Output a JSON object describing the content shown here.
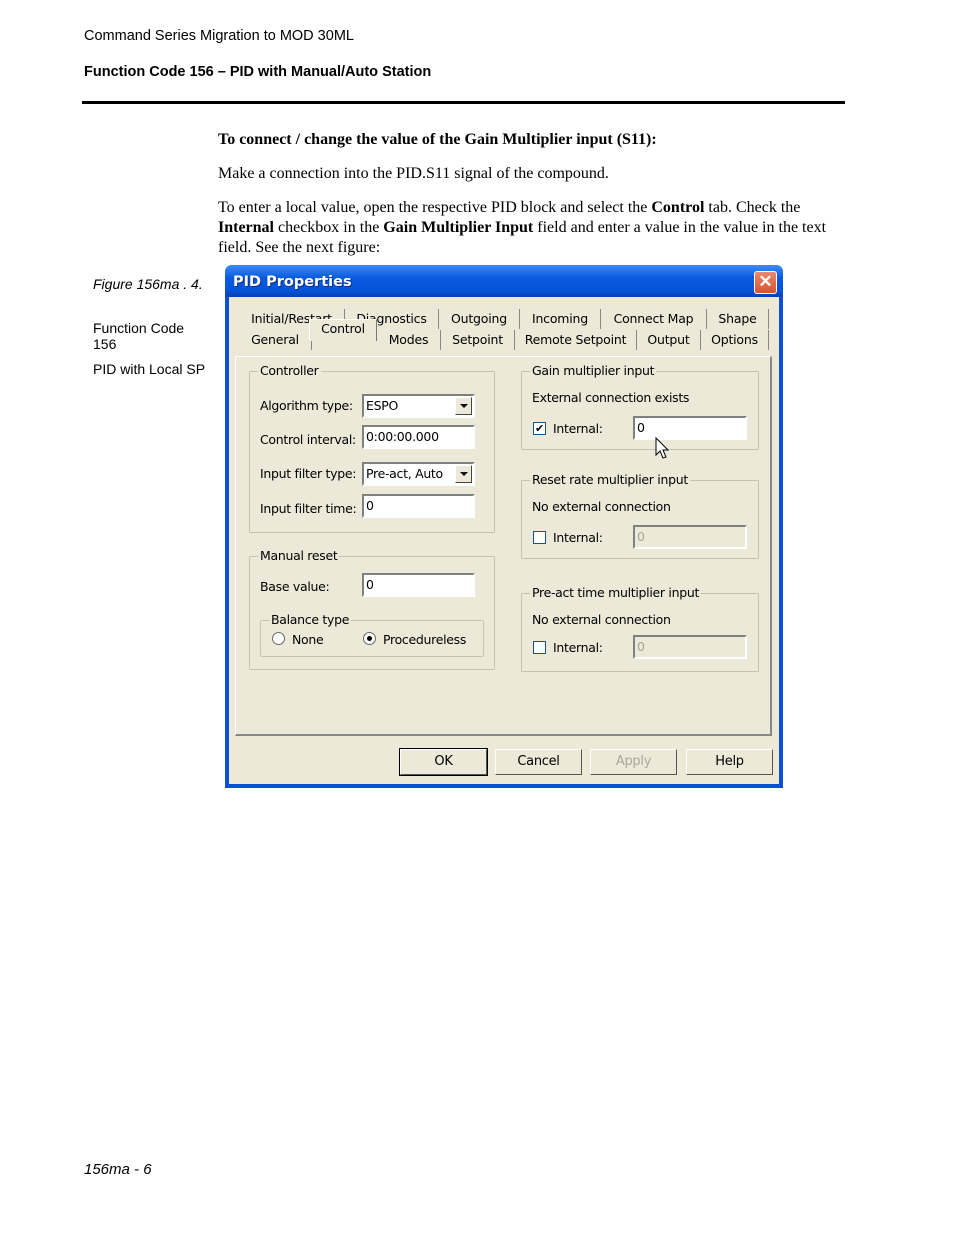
{
  "page_header": {
    "doc_title": "Command Series Migration to MOD 30ML",
    "section_title": "Function Code 156 – PID with Manual/Auto Station"
  },
  "body": {
    "heading": "To connect / change the value of the Gain Multiplier input (S11):",
    "para1": "Make a connection into the PID.S11 signal of the compound.",
    "para2_parts": {
      "a": "To enter a local value, open the respective PID block and select the ",
      "b": "Control",
      "c": " tab. Check the ",
      "d": "Internal",
      "e": " checkbox in the ",
      "f": "Gain Multiplier Input",
      "g": " field and enter a value in the value in the text field. See the next figure:"
    }
  },
  "figure_caption": {
    "figure": "Figure 156ma . 4.",
    "function_code": "Function Code 156",
    "description": "PID with Local SP"
  },
  "dialog": {
    "title": "PID Properties",
    "close_icon": "close-icon",
    "tabs_row1": [
      "Initial/Restart",
      "Diagnostics",
      "Outgoing",
      "Incoming",
      "Connect Map",
      "Shape"
    ],
    "tabs_row2": [
      "General",
      "Control",
      "Modes",
      "Setpoint",
      "Remote Setpoint",
      "Output",
      "Options"
    ],
    "active_tab": "Control",
    "controller": {
      "legend": "Controller",
      "algorithm_label": "Algorithm type:",
      "algorithm_value": "ESPO",
      "interval_label": "Control interval:",
      "interval_value": "0:00:00.000",
      "filter_type_label": "Input filter type:",
      "filter_type_value": "Pre-act, Auto",
      "filter_time_label": "Input filter time:",
      "filter_time_value": "0"
    },
    "manual_reset": {
      "legend": "Manual reset",
      "base_label": "Base value:",
      "base_value": "0",
      "balance_legend": "Balance type",
      "radio_none": "None",
      "radio_procedureless": "Procedureless",
      "selected": "Procedureless"
    },
    "gain": {
      "legend": "Gain multiplier input",
      "status": "External connection exists",
      "internal_label": "Internal:",
      "checked": true,
      "value": "0"
    },
    "reset_rate": {
      "legend": "Reset rate multiplier input",
      "status": "No external connection",
      "internal_label": "Internal:",
      "checked": false,
      "value": "0"
    },
    "preact": {
      "legend": "Pre-act time multiplier input",
      "status": "No external connection",
      "internal_label": "Internal:",
      "checked": false,
      "value": "0"
    },
    "buttons": {
      "ok": "OK",
      "cancel": "Cancel",
      "apply": "Apply",
      "help": "Help"
    },
    "check_mark": "✔",
    "close_glyph": "✕"
  },
  "footer": {
    "page_number": "156ma - 6"
  }
}
